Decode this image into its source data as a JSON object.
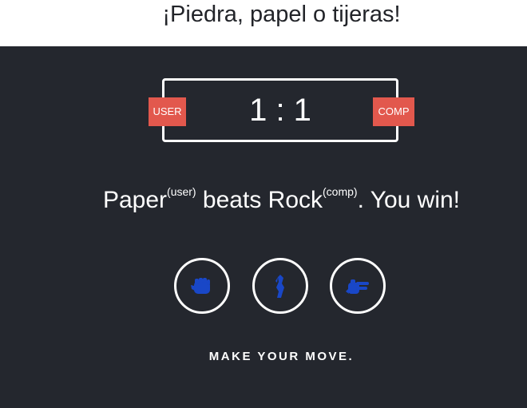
{
  "header": {
    "title": "¡Piedra, papel o tijeras!"
  },
  "scoreboard": {
    "user_label": "USER",
    "comp_label": "COMP",
    "score": "1 : 1"
  },
  "result": {
    "user_choice": "Paper",
    "user_tag": "(user)",
    "verb": " beats ",
    "comp_choice": "Rock",
    "comp_tag": "(comp)",
    "outcome": ". You win!"
  },
  "choices": [
    {
      "name": "rock",
      "icon": "fist-icon"
    },
    {
      "name": "paper",
      "icon": "open-hand-icon"
    },
    {
      "name": "scissors",
      "icon": "scissors-hand-icon"
    }
  ],
  "prompt": "MAKE YOUR MOVE.",
  "colors": {
    "background": "#24272e",
    "badge": "#e2584d",
    "icon": "#1947c7",
    "header_bg": "#ffffff"
  }
}
